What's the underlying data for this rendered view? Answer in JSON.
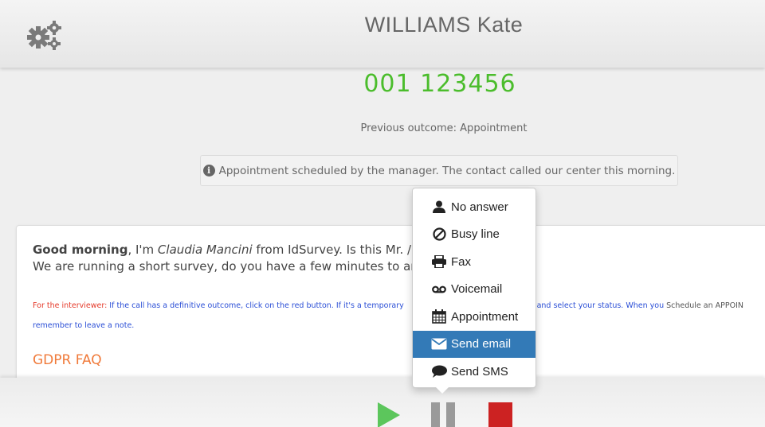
{
  "header": {
    "contact_name": "WILLIAMS Kate"
  },
  "phone": "001 123456",
  "previous_outcome": "Previous outcome: Appointment",
  "info_note": "Appointment scheduled by the manager. The contact called our center this morning.",
  "script": {
    "greeting_bold": "Good morning",
    "greeting_text1": ", I'm ",
    "agent_name": "Claudia Mancini",
    "greeting_text2": " from IdSurvey. Is this ",
    "salutation": "Mr. /Mrs",
    "survey_line": "We are running a short survey, do you have a few minutes to ans",
    "instr_label": "For the interviewer:",
    "instr_text1": " If the call has a definitive outcome, click on the red button. If it's a temporary",
    "instr_text2": "on and select your status. When you",
    "instr_text3": " Schedule an APPOIN",
    "instr_line2": "remember to leave a note.",
    "section_title": "GDPR FAQ"
  },
  "status_menu": {
    "items": [
      {
        "label": "No answer",
        "icon": "user-icon"
      },
      {
        "label": "Busy line",
        "icon": "ban-icon"
      },
      {
        "label": "Fax",
        "icon": "printer-icon"
      },
      {
        "label": "Voicemail",
        "icon": "voicemail-icon"
      },
      {
        "label": "Appointment",
        "icon": "calendar-icon"
      },
      {
        "label": "Send email",
        "icon": "envelope-icon",
        "active": true
      },
      {
        "label": "Send SMS",
        "icon": "comment-icon"
      }
    ]
  },
  "colors": {
    "phone": "#4bbd2c",
    "play": "#5cc65c",
    "stop": "#cc2222",
    "active_item": "#337ab7",
    "section_title": "#f07a3a"
  }
}
